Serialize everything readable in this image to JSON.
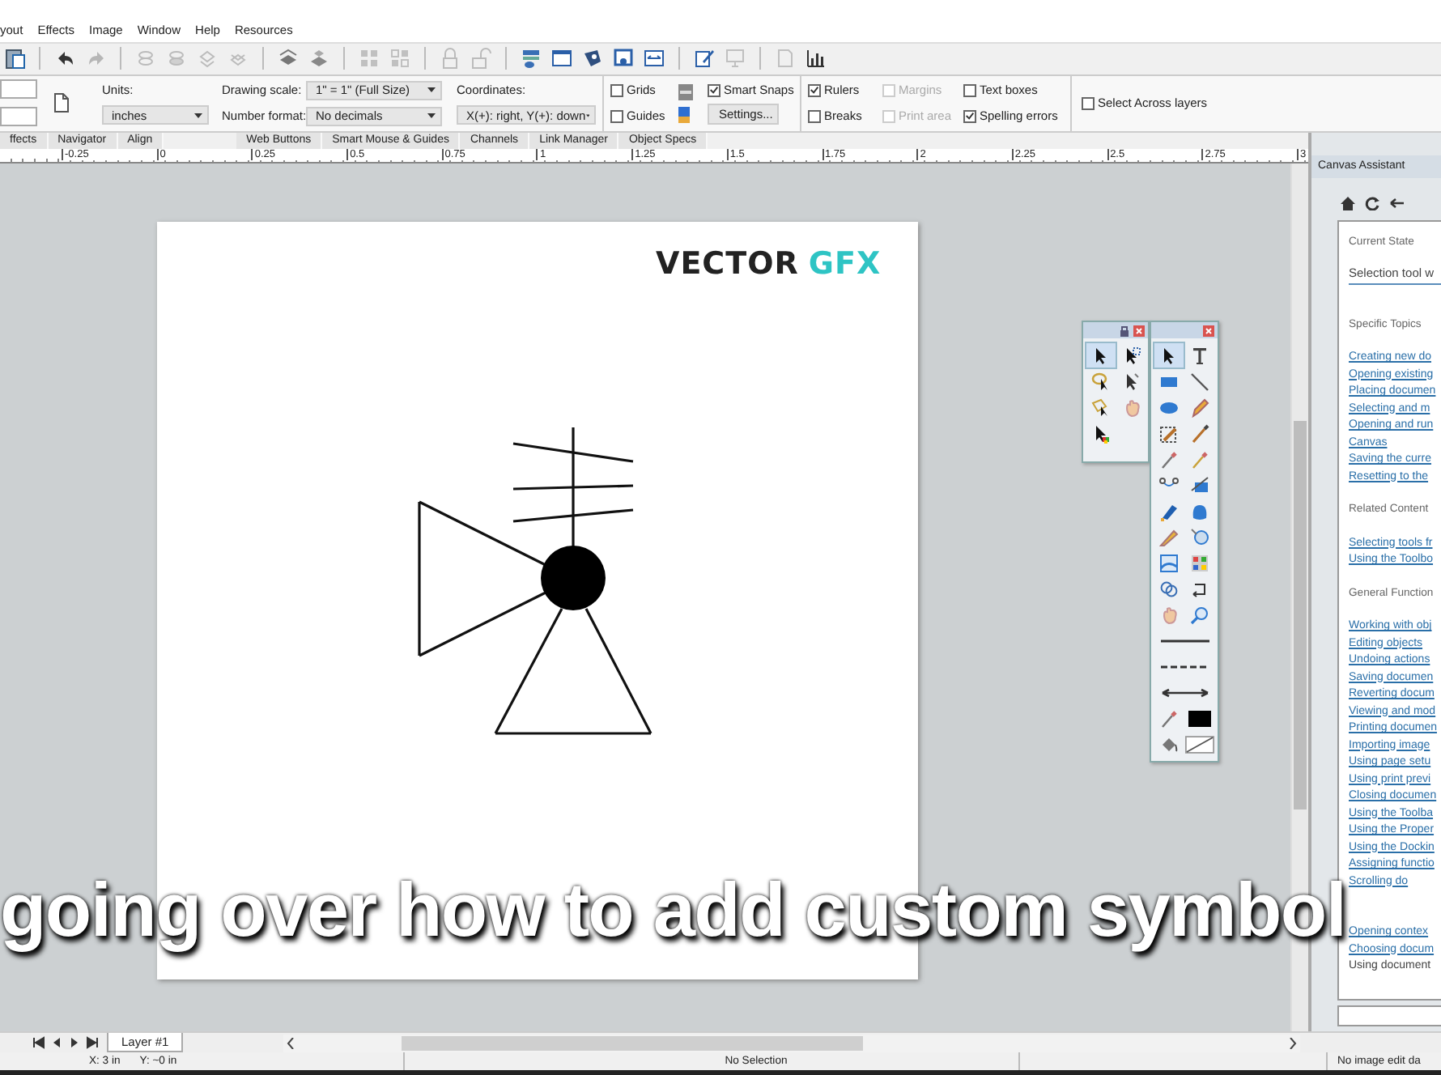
{
  "menu": [
    "yout",
    "Effects",
    "Image",
    "Window",
    "Help",
    "Resources"
  ],
  "toolbar": [
    {
      "kind": "paste",
      "disabled": false
    },
    {
      "kind": "undo",
      "disabled": false
    },
    {
      "kind": "redo",
      "disabled": true
    },
    {
      "kind": "layer-up",
      "disabled": true
    },
    {
      "kind": "layer-down",
      "disabled": true
    },
    {
      "kind": "layer-top",
      "disabled": true
    },
    {
      "kind": "layer-bottom",
      "disabled": true
    },
    {
      "kind": "group",
      "disabled": false
    },
    {
      "kind": "ungroup",
      "disabled": false
    },
    {
      "kind": "grid",
      "disabled": true
    },
    {
      "kind": "grid-alt",
      "disabled": true
    },
    {
      "kind": "lock",
      "disabled": true
    },
    {
      "kind": "unlock",
      "disabled": true
    },
    {
      "kind": "link",
      "disabled": false
    },
    {
      "kind": "window",
      "disabled": false
    },
    {
      "kind": "palette",
      "disabled": false
    },
    {
      "kind": "frame",
      "disabled": false
    },
    {
      "kind": "split",
      "disabled": false
    },
    {
      "kind": "edit",
      "disabled": false
    },
    {
      "kind": "monitor",
      "disabled": true
    },
    {
      "kind": "export",
      "disabled": true
    },
    {
      "kind": "chart",
      "disabled": false
    }
  ],
  "properties": {
    "units_label": "Units:",
    "units": "inches",
    "scale_label": "Drawing scale:",
    "scale": "1\" = 1\" (Full Size)",
    "format_label": "Number format:",
    "format": "No decimals",
    "coords_label": "Coordinates:",
    "coords": "X(+): right, Y(+): down",
    "settings_button": "Settings...",
    "checkboxes": [
      {
        "label": "Grids",
        "checked": false,
        "disabled": false
      },
      {
        "label": "Guides",
        "checked": false,
        "disabled": false
      },
      {
        "label": "Smart Snaps",
        "checked": true,
        "disabled": false
      },
      {
        "label": "Rulers",
        "checked": true,
        "disabled": false
      },
      {
        "label": "Breaks",
        "checked": false,
        "disabled": false
      },
      {
        "label": "Margins",
        "checked": false,
        "disabled": true
      },
      {
        "label": "Print area",
        "checked": false,
        "disabled": true
      },
      {
        "label": "Text boxes",
        "checked": false,
        "disabled": false
      },
      {
        "label": "Spelling errors",
        "checked": true,
        "disabled": false
      },
      {
        "label": "Select Across layers",
        "checked": false,
        "disabled": false
      }
    ]
  },
  "panel_tabs": [
    {
      "label": "ffects",
      "selected": false
    },
    {
      "label": "Navigator",
      "selected": false
    },
    {
      "label": "Align",
      "selected": false
    },
    {
      "label": "Web Buttons",
      "selected": false
    },
    {
      "label": "Smart Mouse & Guides",
      "selected": false
    },
    {
      "label": "Channels",
      "selected": false
    },
    {
      "label": "Link Manager",
      "selected": false
    },
    {
      "label": "Object Specs",
      "selected": false
    }
  ],
  "ruler": [
    "-0.25",
    "0",
    "0.25",
    "0.5",
    "0.75",
    "1",
    "1.25",
    "1.5",
    "1.75",
    "2",
    "2.25",
    "2.5",
    "2.75",
    "3"
  ],
  "canvas": {
    "logo": [
      "VECTOR",
      "GFX"
    ],
    "palettes": [
      {
        "tools": [
          {
            "kind": "pointer",
            "selected": true
          },
          {
            "kind": "subselect",
            "selected": false
          },
          {
            "kind": "lasso",
            "selected": false
          },
          {
            "kind": "pointer-alt",
            "selected": false
          },
          {
            "kind": "poly-lasso",
            "selected": false
          },
          {
            "kind": "hand",
            "selected": false
          },
          {
            "kind": "color-pointer",
            "selected": false
          }
        ]
      },
      {
        "tools": [
          {
            "kind": "pointer",
            "selected": true
          },
          {
            "kind": "text",
            "selected": false
          },
          {
            "kind": "rect",
            "selected": false
          },
          {
            "kind": "line",
            "selected": false
          },
          {
            "kind": "ellipse",
            "selected": false
          },
          {
            "kind": "pen",
            "selected": false
          },
          {
            "kind": "crop",
            "selected": false
          },
          {
            "kind": "brush",
            "selected": false
          },
          {
            "kind": "dropper",
            "selected": false
          },
          {
            "kind": "dropper-alt",
            "selected": false
          },
          {
            "kind": "node",
            "selected": false
          },
          {
            "kind": "connector",
            "selected": false
          },
          {
            "kind": "marker",
            "selected": false
          },
          {
            "kind": "blob",
            "selected": false
          },
          {
            "kind": "knife",
            "selected": false
          },
          {
            "kind": "compass",
            "selected": false
          },
          {
            "kind": "image",
            "selected": false
          },
          {
            "kind": "effects",
            "selected": false
          },
          {
            "kind": "loops",
            "selected": false
          },
          {
            "kind": "flow",
            "selected": false
          },
          {
            "kind": "hand",
            "selected": false
          },
          {
            "kind": "zoom",
            "selected": false
          },
          {
            "kind": "solid-line",
            "selected": false
          },
          {
            "kind": "dashed-line",
            "selected": false
          },
          {
            "kind": "arrow-line",
            "selected": false
          },
          {
            "kind": "dropper",
            "selected": false
          },
          {
            "kind": "swatch",
            "selected": false,
            "color": "#000000"
          },
          {
            "kind": "bucket",
            "selected": false
          },
          {
            "kind": "no-fill",
            "selected": false
          }
        ]
      }
    ]
  },
  "assistant": {
    "title": "Canvas Assistant",
    "sections": [
      {
        "heading": "Current State",
        "field": "Selection tool w"
      },
      {
        "heading": "Specific Topics",
        "items": [
          {
            "kind": "link",
            "text": "Creating new do"
          },
          {
            "kind": "link",
            "text": "Opening existing"
          },
          {
            "kind": "link",
            "text": "Placing documen"
          },
          {
            "kind": "link",
            "text": "Selecting and m"
          },
          {
            "kind": "link",
            "text": "Opening and run"
          },
          {
            "kind": "link",
            "text": "Canvas"
          },
          {
            "kind": "link",
            "text": "Saving the curre"
          },
          {
            "kind": "link",
            "text": "Resetting to the"
          }
        ]
      },
      {
        "heading": "Related Content",
        "items": [
          {
            "kind": "link",
            "text": "Selecting tools fr"
          },
          {
            "kind": "link",
            "text": "Using the Toolbo"
          }
        ]
      },
      {
        "heading": "General Function",
        "items": [
          {
            "kind": "link",
            "text": "Working with obj"
          },
          {
            "kind": "link",
            "text": "Editing objects"
          },
          {
            "kind": "link",
            "text": "Undoing actions"
          },
          {
            "kind": "link",
            "text": "Saving documen"
          },
          {
            "kind": "link",
            "text": "Reverting docum"
          },
          {
            "kind": "link",
            "text": "Viewing and mod"
          },
          {
            "kind": "link",
            "text": "Printing documen"
          },
          {
            "kind": "link",
            "text": "Importing image"
          },
          {
            "kind": "link",
            "text": "Using page setu"
          },
          {
            "kind": "link",
            "text": "Using print previ"
          },
          {
            "kind": "link",
            "text": "Closing documen"
          },
          {
            "kind": "link",
            "text": "Using the Toolba"
          },
          {
            "kind": "link",
            "text": "Using the Proper"
          },
          {
            "kind": "link",
            "text": "Using the Dockin"
          },
          {
            "kind": "link",
            "text": "Assigning functio"
          },
          {
            "kind": "link",
            "text": "Scrolling do"
          },
          {
            "kind": "link",
            "text": "Opening contex"
          },
          {
            "kind": "link",
            "text": "Choosing docum"
          },
          {
            "kind": "text",
            "text": "Using document"
          }
        ]
      }
    ]
  },
  "layer_tab": "Layer #1",
  "status": {
    "x": "X: 3 in",
    "y": "Y: ~0 in",
    "selection": "No Selection",
    "image": "No image edit da"
  },
  "caption": "going over how to add custom symbol"
}
